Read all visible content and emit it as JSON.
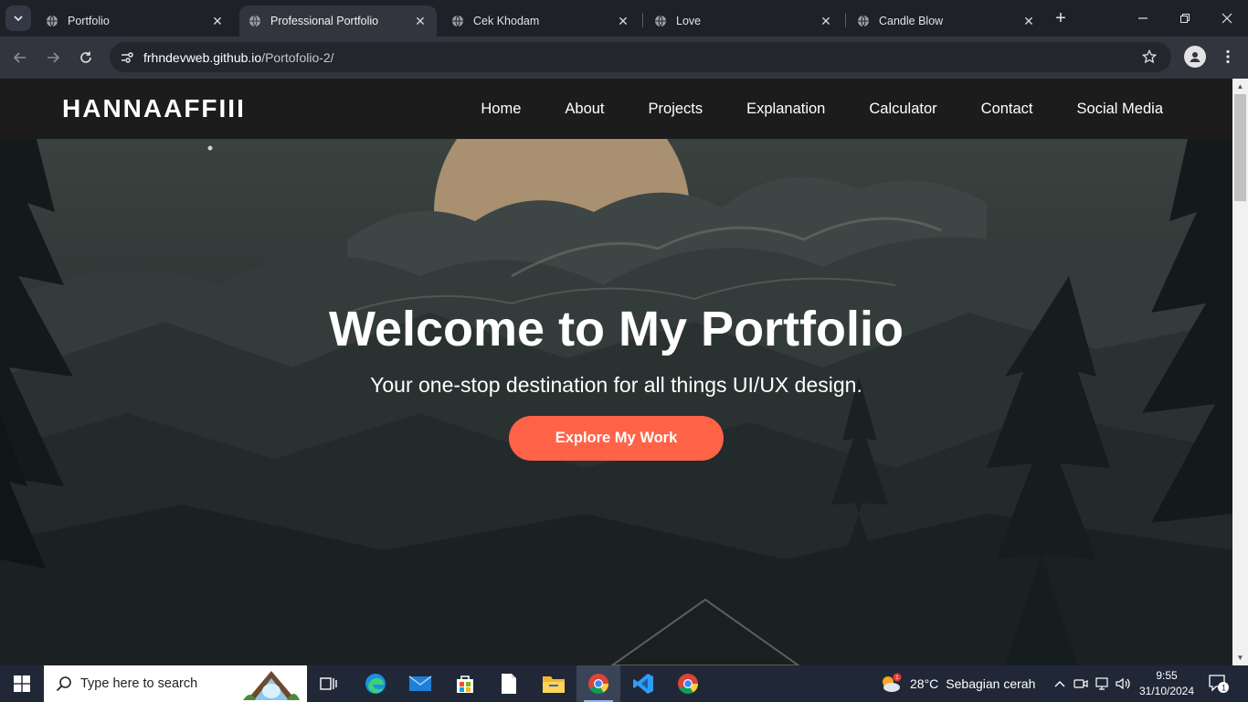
{
  "browser": {
    "tabs": [
      {
        "title": "Portfolio",
        "active": false
      },
      {
        "title": "Professional Portfolio",
        "active": true
      },
      {
        "title": "Cek Khodam",
        "active": false
      },
      {
        "title": "Love",
        "active": false
      },
      {
        "title": "Candle Blow",
        "active": false
      }
    ],
    "url_host": "frhndevweb.github.io",
    "url_path": "/Portofolio-2/"
  },
  "site": {
    "logo": "HANNAAFFIII",
    "menu": [
      "Home",
      "About",
      "Projects",
      "Explanation",
      "Calculator",
      "Contact",
      "Social Media"
    ],
    "hero": {
      "title": "Welcome to My Portfolio",
      "subtitle": "Your one-stop destination for all things UI/UX design.",
      "button": "Explore My Work",
      "button_color": "#ff6347"
    }
  },
  "taskbar": {
    "search_placeholder": "Type here to search",
    "apps": [
      "task-view-icon",
      "edge-icon",
      "mail-icon",
      "store-icon",
      "notepad-icon",
      "file-explorer-icon",
      "chrome-icon",
      "vscode-icon",
      "chrome-icon"
    ],
    "weather": {
      "temp": "28°C",
      "desc": "Sebagian cerah",
      "badge": "1"
    },
    "time": "9:55",
    "date": "31/10/2024",
    "notification_count": "1"
  }
}
